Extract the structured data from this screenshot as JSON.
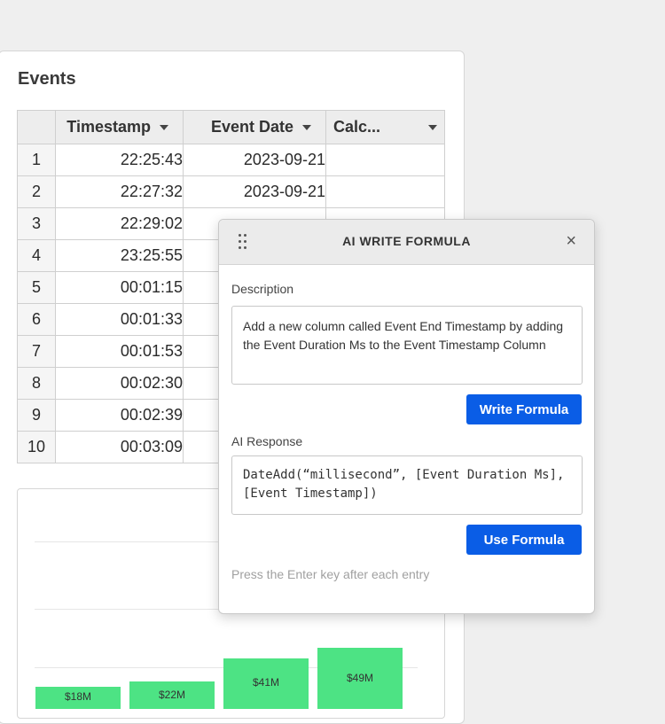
{
  "panel": {
    "title": "Events"
  },
  "table": {
    "columns": [
      "Timestamp",
      "Event Date",
      "Calc..."
    ],
    "rows": [
      {
        "idx": "1",
        "timestamp": "22:25:43",
        "event_date": "2023-09-21",
        "calc": ""
      },
      {
        "idx": "2",
        "timestamp": "22:27:32",
        "event_date": "2023-09-21",
        "calc": ""
      },
      {
        "idx": "3",
        "timestamp": "22:29:02",
        "event_date": "",
        "calc": ""
      },
      {
        "idx": "4",
        "timestamp": "23:25:55",
        "event_date": "",
        "calc": ""
      },
      {
        "idx": "5",
        "timestamp": "00:01:15",
        "event_date": "",
        "calc": ""
      },
      {
        "idx": "6",
        "timestamp": "00:01:33",
        "event_date": "",
        "calc": ""
      },
      {
        "idx": "7",
        "timestamp": "00:01:53",
        "event_date": "",
        "calc": ""
      },
      {
        "idx": "8",
        "timestamp": "00:02:30",
        "event_date": "",
        "calc": ""
      },
      {
        "idx": "9",
        "timestamp": "00:02:39",
        "event_date": "",
        "calc": ""
      },
      {
        "idx": "10",
        "timestamp": "00:03:09",
        "event_date": "",
        "calc": ""
      }
    ]
  },
  "chart_data": {
    "type": "bar",
    "categories": [],
    "values": [
      18,
      22,
      41,
      49
    ],
    "data_labels": [
      "$18M",
      "$22M",
      "$41M",
      "$49M"
    ],
    "color": "#4de384"
  },
  "dialog": {
    "title": "AI WRITE FORMULA",
    "close_icon": "×",
    "description_label": "Description",
    "description_text": "Add a new column called Event End Timestamp by adding the Event Duration Ms to the Event Timestamp Column",
    "write_button": "Write Formula",
    "response_label": "AI Response",
    "response_text": "DateAdd(“millisecond”, [Event Duration Ms], [Event Timestamp])",
    "use_button": "Use Formula",
    "hint": "Press the Enter key after each entry"
  },
  "colors": {
    "accent": "#0a5de6",
    "selection": "#2d6fd6",
    "bar": "#4de384"
  }
}
